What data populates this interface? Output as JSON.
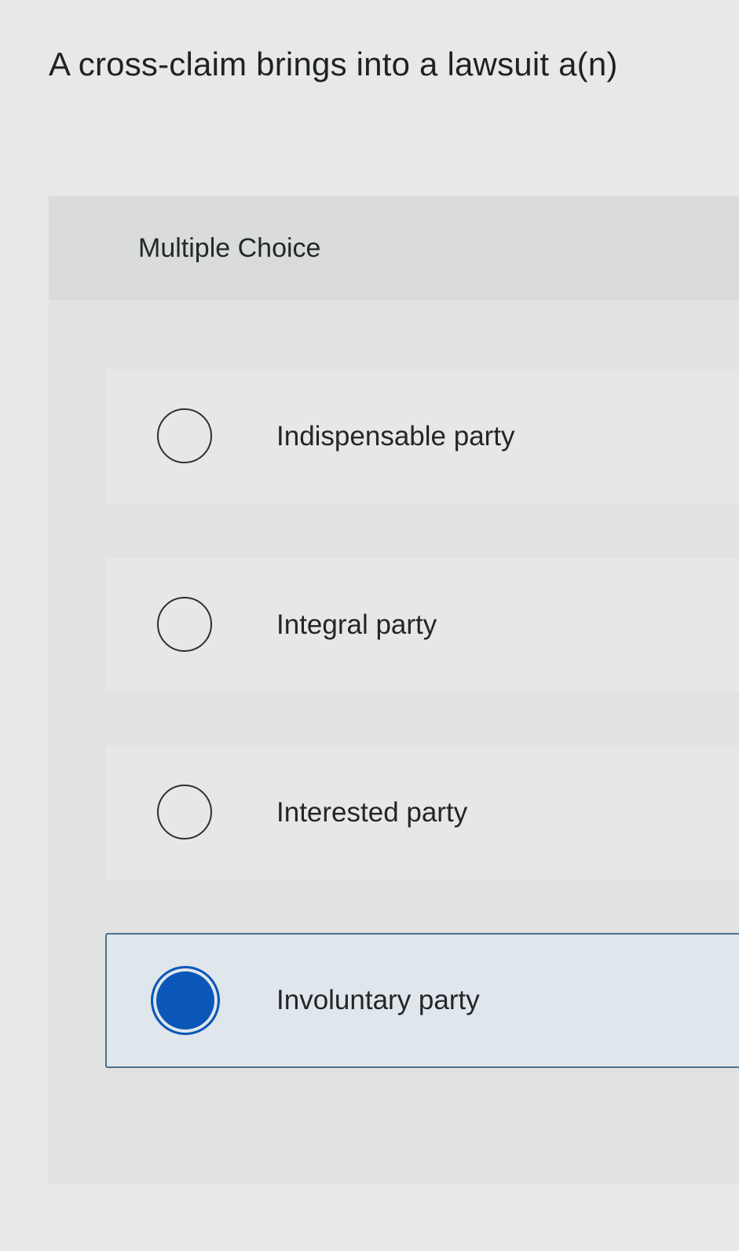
{
  "question": {
    "text": "A cross-claim brings into a lawsuit a(n)"
  },
  "panel": {
    "type_label": "Multiple Choice",
    "options": [
      {
        "label": "Indispensable party",
        "selected": false
      },
      {
        "label": "Integral party",
        "selected": false
      },
      {
        "label": "Interested party",
        "selected": false
      },
      {
        "label": "Involuntary party",
        "selected": true
      }
    ]
  },
  "colors": {
    "selected_radio": "#0b57b8",
    "selected_border": "#4d6e8e",
    "selected_background": "#dfe6ec"
  }
}
